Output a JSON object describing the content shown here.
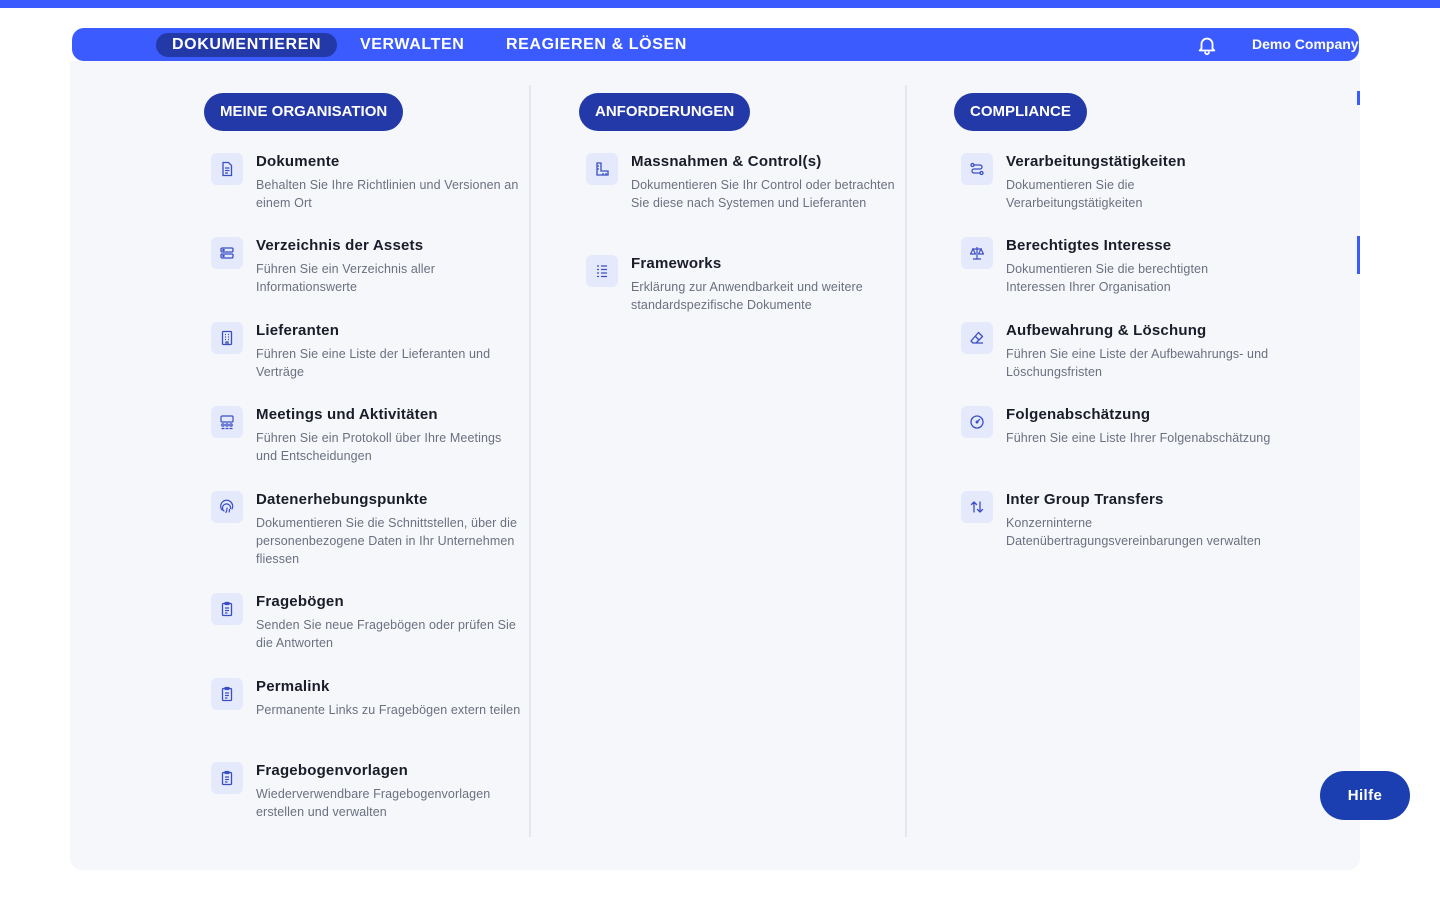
{
  "nav": {
    "tabs": [
      {
        "label": "DOKUMENTIEREN",
        "active": true
      },
      {
        "label": "VERWALTEN",
        "active": false
      },
      {
        "label": "REAGIEREN & LÖSEN",
        "active": false
      }
    ],
    "company": "Demo Company",
    "icons": {
      "notifications": "bell-icon",
      "settings": "gear-icon"
    }
  },
  "colors": {
    "primary": "#3b5bff",
    "active_tab": "#2339a8",
    "panel_bg": "#f5f7fa",
    "icon_tint": "#3b4fc4",
    "help_button": "#1b3fb0"
  },
  "sections": [
    {
      "title": "MEINE ORGANISATION",
      "items": [
        {
          "icon": "document-icon",
          "title": "Dokumente",
          "desc": "Behalten Sie Ihre Richtlinien und Versionen an einem Ort"
        },
        {
          "icon": "server-icon",
          "title": "Verzeichnis der Assets",
          "desc": "Führen Sie ein Verzeichnis aller Informationswerte"
        },
        {
          "icon": "building-icon",
          "title": "Lieferanten",
          "desc": "Führen Sie eine Liste der Lieferanten und Verträge"
        },
        {
          "icon": "meeting-icon",
          "title": "Meetings und Aktivitäten",
          "desc": "Führen Sie ein Protokoll über Ihre Meetings und Entscheidungen"
        },
        {
          "icon": "fingerprint-icon",
          "title": "Datenerhebungspunkte",
          "desc": "Dokumentieren Sie die Schnittstellen, über die personenbezogene Daten in Ihr Unternehmen fliessen"
        },
        {
          "icon": "clipboard-icon",
          "title": "Fragebögen",
          "desc": "Senden Sie neue Fragebögen oder prüfen Sie die Antworten"
        },
        {
          "icon": "clipboard-icon",
          "title": "Permalink",
          "desc": "Permanente Links zu Fragebögen extern teilen"
        },
        {
          "icon": "clipboard-icon",
          "title": "Fragebogenvorlagen",
          "desc": "Wiederverwendbare Fragebogenvorlagen erstellen und verwalten"
        }
      ]
    },
    {
      "title": "ANFORDERUNGEN",
      "items": [
        {
          "icon": "ruler-icon",
          "title": "Massnahmen & Control(s)",
          "desc": "Dokumentieren Sie Ihr Control oder betrachten Sie diese nach Systemen und Lieferanten"
        },
        {
          "icon": "list-icon",
          "title": "Frameworks",
          "desc": "Erklärung zur Anwendbarkeit und weitere standardspezifische Dokumente"
        }
      ]
    },
    {
      "title": "COMPLIANCE",
      "items": [
        {
          "icon": "route-icon",
          "title": "Verarbeitungstätigkeiten",
          "desc": "Dokumentieren Sie die Verarbeitungstätigkeiten"
        },
        {
          "icon": "scale-icon",
          "title": "Berechtigtes Interesse",
          "desc": "Dokumentieren Sie die berechtigten Interessen Ihrer Organisation"
        },
        {
          "icon": "eraser-icon",
          "title": "Aufbewahrung & Löschung",
          "desc": "Führen Sie eine Liste der Aufbewahrungs- und Löschungsfristen"
        },
        {
          "icon": "gauge-icon",
          "title": "Folgenabschätzung",
          "desc": "Führen Sie eine Liste Ihrer Folgenabschätzung"
        },
        {
          "icon": "transfer-icon",
          "title": "Inter Group Transfers",
          "desc": "Konzerninterne Datenübertragungsvereinbarungen verwalten"
        }
      ]
    }
  ],
  "help": {
    "label": "Hilfe"
  }
}
